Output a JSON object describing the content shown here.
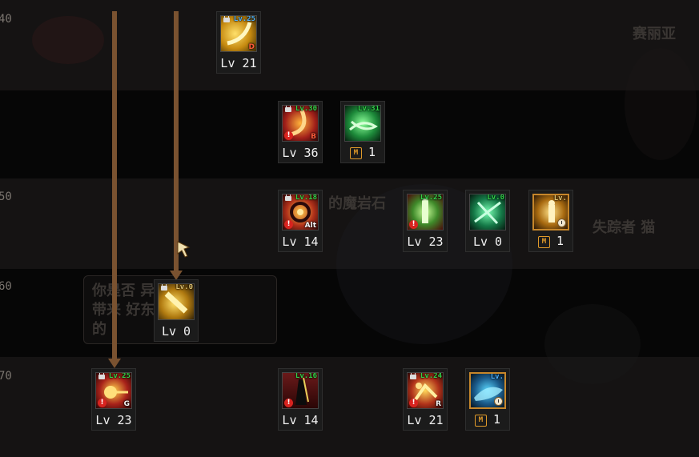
{
  "rows": [
    {
      "label": "40"
    },
    {
      "label": "50"
    },
    {
      "label": "60"
    },
    {
      "label": "70"
    }
  ],
  "background_text": {
    "name_top_right": "赛丽亚",
    "mid_text": "的魔岩石",
    "npc_text": "失踪者 猫",
    "box_line1": "你是否 异空间",
    "box_line2": "带来 好东西",
    "box_line3": "的"
  },
  "skills": [
    {
      "id": "s1",
      "req": "Lv.25",
      "req_color": "blue",
      "locked": true,
      "tag": "D",
      "warn": false,
      "level": "Lv 21"
    },
    {
      "id": "s2",
      "req": "Lv.30",
      "req_color": "green",
      "locked": true,
      "tag": "B",
      "warn": true,
      "level": "Lv 36"
    },
    {
      "id": "s3",
      "req": "Lv.31",
      "req_color": "green",
      "locked": false,
      "tag": "",
      "warn": false,
      "mastery": "M",
      "level": "1"
    },
    {
      "id": "s4",
      "req": "Lv.18",
      "req_color": "green",
      "locked": true,
      "tag": "Alt",
      "warn": true,
      "level": "Lv 14"
    },
    {
      "id": "s5",
      "req": "Lv.25",
      "req_color": "green",
      "locked": false,
      "tag": "",
      "warn": true,
      "level": "Lv 23"
    },
    {
      "id": "s6",
      "req": "Lv.0",
      "req_color": "green",
      "locked": false,
      "tag": "",
      "warn": false,
      "level": "Lv 0"
    },
    {
      "id": "s7",
      "req": "Lv.",
      "req_color": "gold",
      "locked": false,
      "tag": "",
      "warn": false,
      "mastery": "M",
      "level": "1"
    },
    {
      "id": "s8",
      "req": "Lv.0",
      "req_color": "gold",
      "locked": true,
      "tag": "",
      "warn": false,
      "level": "Lv 0"
    },
    {
      "id": "s9",
      "req": "Lv.25",
      "req_color": "green",
      "locked": true,
      "tag": "G",
      "warn": true,
      "level": "Lv 23"
    },
    {
      "id": "s10",
      "req": "Lv.16",
      "req_color": "green",
      "locked": false,
      "tag": "",
      "warn": true,
      "level": "Lv 14"
    },
    {
      "id": "s11",
      "req": "Lv.24",
      "req_color": "green",
      "locked": true,
      "tag": "R",
      "warn": true,
      "level": "Lv 21"
    },
    {
      "id": "s12",
      "req": "Lv.",
      "req_color": "blue",
      "locked": false,
      "tag": "",
      "warn": false,
      "mastery": "M",
      "level": "1"
    }
  ],
  "colors": {
    "arrow": "#7a5230",
    "req_green": "#33d24a",
    "req_blue": "#4fb2ff",
    "mastery_border": "#c6862a"
  }
}
